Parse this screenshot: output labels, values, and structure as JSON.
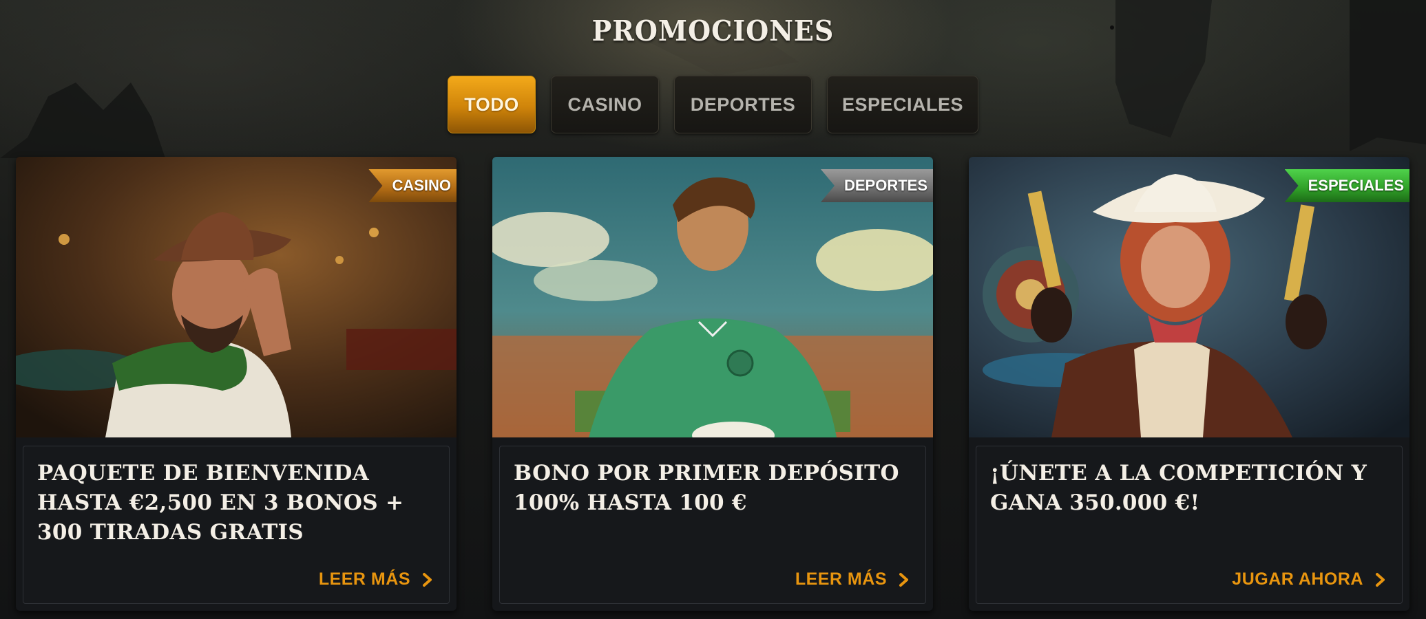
{
  "page": {
    "title": "PROMOCIONES"
  },
  "tabs": [
    {
      "label": "TODO",
      "active": true
    },
    {
      "label": "CASINO",
      "active": false
    },
    {
      "label": "DEPORTES",
      "active": false
    },
    {
      "label": "ESPECIALES",
      "active": false
    }
  ],
  "cards": [
    {
      "badge": "CASINO",
      "badge_color": "#b06a14",
      "image_icon": "cowboy-illustration",
      "title": "PAQUETE DE BIENVENIDA HASTA €2,500 EN 3 BONOS + 300 TIRADAS GRATIS",
      "cta": "LEER MÁS"
    },
    {
      "badge": "DEPORTES",
      "badge_color": "#6e6e6e",
      "image_icon": "soccer-player-illustration",
      "title": "BONO POR PRIMER DEPÓSITO 100% HASTA 100 €",
      "cta": "LEER MÁS"
    },
    {
      "badge": "ESPECIALES",
      "badge_color": "#2f9f27",
      "image_icon": "cowgirl-illustration",
      "title": "¡ÚNETE A LA COMPETICIÓN Y GANA 350.000 €!",
      "cta": "JUGAR AHORA"
    }
  ],
  "colors": {
    "accent": "#e8950f",
    "card_bg": "#15171a",
    "title_text": "#f4efe6"
  }
}
